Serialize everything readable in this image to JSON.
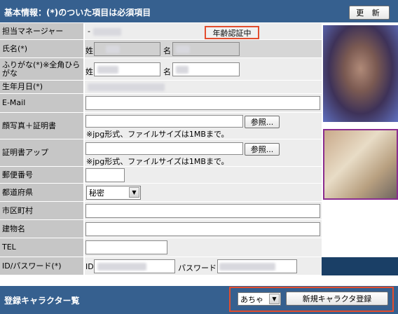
{
  "header": {
    "title": "基本情報：(*)のついた項目は必須項目",
    "update_label": "更 新"
  },
  "rows": {
    "manager": {
      "label": "担当マネージャー",
      "dash": "-",
      "badge": "年齢認証中"
    },
    "name": {
      "label": "氏名(*)",
      "sei": "姓",
      "mei": "名"
    },
    "furigana": {
      "label": "ふりがな(*)※全角ひらがな",
      "sei": "姓",
      "mei": "名"
    },
    "birthday": {
      "label": "生年月日(*)"
    },
    "email": {
      "label": "E-Mail"
    },
    "photo_cert": {
      "label": "顔写真＋証明書",
      "browse": "参照...",
      "note": "※jpg形式、ファイルサイズは1MBまで。"
    },
    "cert_upload": {
      "label": "証明書アップ",
      "browse": "参照...",
      "note": "※jpg形式、ファイルサイズは1MBまで。"
    },
    "postal": {
      "label": "郵便番号"
    },
    "prefecture": {
      "label": "都道府県",
      "selected": "秘密"
    },
    "city": {
      "label": "市区町村"
    },
    "building": {
      "label": "建物名"
    },
    "tel": {
      "label": "TEL"
    },
    "idpw": {
      "label": "ID/パスワード(*)",
      "id_prefix": "ID",
      "pw_prefix": "パスワード"
    }
  },
  "footer": {
    "title": "登録キャラクター覧",
    "selected_character": "あちゃ",
    "register_label": "新規キャラクタ登録"
  },
  "colors": {
    "header_bg": "#36608f",
    "label_bg": "#c6c6c6",
    "value_bg": "#ededed",
    "highlight": "#e34d2e"
  }
}
